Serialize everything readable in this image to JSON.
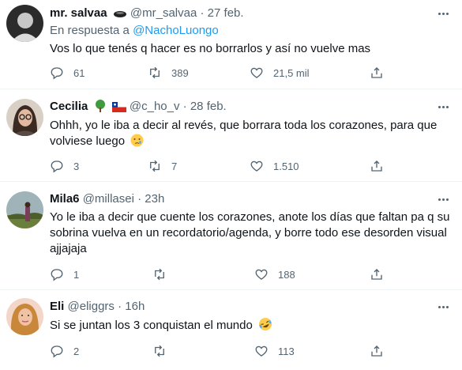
{
  "tweets": [
    {
      "name": "mr. salvaa",
      "name_emoji": "black-oval-emoji",
      "handle": "@mr_salvaa",
      "separator": "·",
      "time": "27 feb.",
      "reply_prefix": "En respuesta a",
      "reply_handle": "@NachoLuongo",
      "text": "Vos lo que tenés q hacer es no borrarlos y así no vuelve mas",
      "replies": "61",
      "retweets": "389",
      "likes": "21,5 mil"
    },
    {
      "name": "Cecilia",
      "name_emoji": "tree-emoji chile-flag-emoji",
      "handle": "@c_ho_v",
      "separator": "·",
      "time": "28 feb.",
      "text": "Ohhh, yo le iba a decir al revés, que borrara toda los corazones, para que volviese luego",
      "text_emoji": "crying-face-emoji",
      "replies": "3",
      "retweets": "7",
      "likes": "1.510"
    },
    {
      "name": "Mila6",
      "handle": "@millasei",
      "separator": "·",
      "time": "23h",
      "text": "Yo le iba a decir que cuente los corazones, anote los días que faltan pa q su sobrina vuelva en un recordatorio/agenda, y borre todo ese desorden visual ajjajaja",
      "replies": "1",
      "retweets": "",
      "likes": "188"
    },
    {
      "name": "Eli",
      "handle": "@eliggrs",
      "separator": "·",
      "time": "16h",
      "text": "Si se juntan los 3 conquistan el mundo",
      "text_emoji": "rolling-laughing-emoji",
      "replies": "2",
      "retweets": "",
      "likes": "113"
    }
  ],
  "colors": {
    "text": "#0f1419",
    "muted": "#536471",
    "link": "#1d9bf0",
    "divider": "#eff3f4"
  }
}
